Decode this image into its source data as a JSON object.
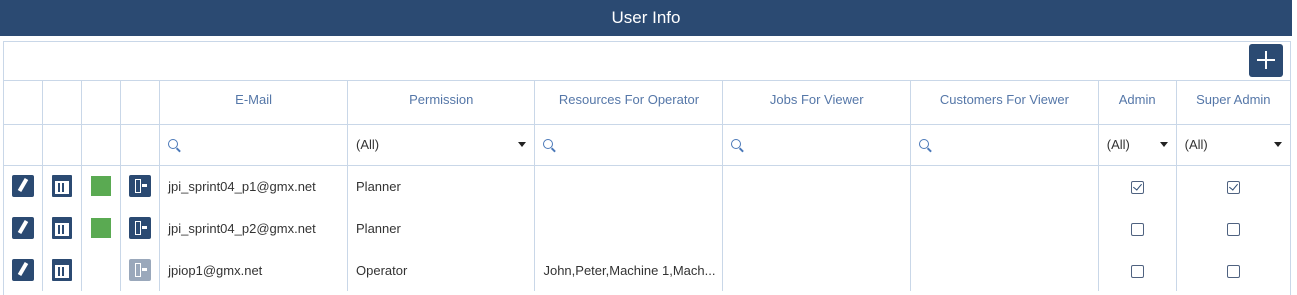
{
  "title": "User Info",
  "toolbar": {
    "add_icon": "plus-icon"
  },
  "columns": {
    "email": "E-Mail",
    "permission": "Permission",
    "resources": "Resources For Operator",
    "jobs": "Jobs For Viewer",
    "customers": "Customers For Viewer",
    "admin": "Admin",
    "super_admin": "Super Admin"
  },
  "filters": {
    "permission": "(All)",
    "admin": "(All)",
    "super_admin": "(All)"
  },
  "rows": [
    {
      "email": "jpi_sprint04_p1@gmx.net",
      "permission": "Planner",
      "resources": "",
      "jobs": "",
      "customers": "",
      "admin": true,
      "super_admin": true,
      "active": true
    },
    {
      "email": "jpi_sprint04_p2@gmx.net",
      "permission": "Planner",
      "resources": "",
      "jobs": "",
      "customers": "",
      "admin": false,
      "super_admin": false,
      "active": true
    },
    {
      "email": "jpiop1@gmx.net",
      "permission": "Operator",
      "resources": "John,Peter,Machine 1,Mach...",
      "jobs": "",
      "customers": "",
      "admin": false,
      "super_admin": false,
      "active": false
    }
  ],
  "colors": {
    "header": "#2b4a72",
    "status_green": "#5aaa52",
    "border": "#c9d7e8"
  }
}
